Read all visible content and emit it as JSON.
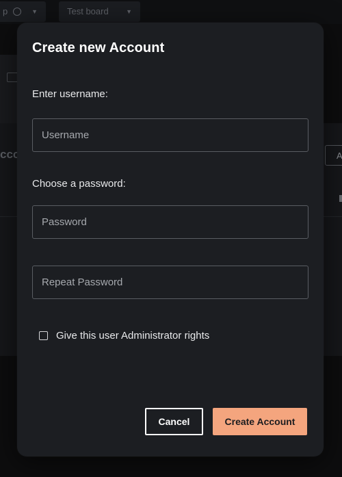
{
  "background": {
    "topbar": {
      "left_dropdown_label": "p",
      "board_dropdown_label": "Test board"
    },
    "side_text": "ccc",
    "right_button_label": "A"
  },
  "modal": {
    "title": "Create new Account",
    "username_label": "Enter username:",
    "username_placeholder": "Username",
    "username_value": "",
    "password_label": "Choose a password:",
    "password_placeholder": "Password",
    "password_value": "",
    "repeat_password_placeholder": "Repeat Password",
    "repeat_password_value": "",
    "admin_checkbox_label": "Give this user Administrator rights",
    "admin_checkbox_checked": false,
    "cancel_label": "Cancel",
    "create_label": "Create Account"
  },
  "colors": {
    "accent": "#f4a57e",
    "modal_bg": "#1c1e22",
    "input_border": "#5a5d63",
    "text": "#e8e9eb"
  },
  "icons": {
    "globe": "globe-icon",
    "caret": "chevron-down-icon",
    "image": "image-icon"
  }
}
